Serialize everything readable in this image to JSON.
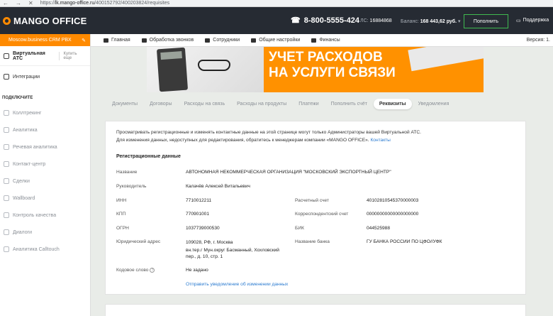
{
  "browser": {
    "url_prefix": "https://",
    "url_host": "lk.mango-office.ru",
    "url_path": "/400152792/400203824/requisites"
  },
  "header": {
    "logo": "MANGO OFFICE",
    "phone": "8-800-5555-424",
    "ls_label": "ЛС:",
    "ls_value": "16884868",
    "balance_label": "Баланс:",
    "balance_value": "168 443,62 руб.",
    "topup_button": "Пополнить",
    "support": "Поддержка"
  },
  "sidebar": {
    "product": "Moscow.business CRM PBX",
    "atc": "Виртуальная АТС",
    "buy_more": "Купить еще",
    "integrations": "Интеграции",
    "connect_section": "ПОДКЛЮЧИТЕ",
    "items": [
      "Коллтрекинг",
      "Аналитика",
      "Речевая аналитика",
      "Контакт-центр",
      "Сделки",
      "Wallboard",
      "Контроль качества",
      "Диалоги",
      "Аналитика Calltouch"
    ]
  },
  "nav": {
    "items": [
      "Главная",
      "Обработка звонков",
      "Сотрудники",
      "Общие настройки",
      "Финансы"
    ],
    "version": "Версия: 1."
  },
  "banner": {
    "line1": "УЧЕТ РАСХОДОВ",
    "line2": "НА УСЛУГИ СВЯЗИ"
  },
  "tabs": [
    "Документы",
    "Договоры",
    "Расходы на связь",
    "Расходы на продукты",
    "Платежи",
    "Пополнить счёт",
    "Реквизиты",
    "Уведомления"
  ],
  "active_tab": "Реквизиты",
  "notice": {
    "line1": "Просматривать регистрационные и изменять контактные данные на этой странице могут только Администраторы вашей Виртуальной АТС.",
    "line2": "Для изменения данных, недоступных для редактирования, обратитесь к менеджерам компании «MANGO OFFICE».",
    "contacts_link": "Контакты"
  },
  "reg": {
    "title": "Регистрационные данные",
    "name_label": "Название",
    "name_value": "АВТОНОМНАЯ НЕКОММЕРЧЕСКАЯ ОРГАНИЗАЦИЯ \"МОСКОВСКИЙ ЭКСПОРТНЫЙ ЦЕНТР\"",
    "head_label": "Руководитель",
    "head_value": "Калачёв Алексей Витальевич",
    "inn_label": "ИНН",
    "inn_value": "7710012211",
    "kpp_label": "КПП",
    "kpp_value": "770901001",
    "ogrn_label": "ОГРН",
    "ogrn_value": "1037739000530",
    "address_label": "Юридический адрес",
    "address_line1": "109028, РФ, г. Москва",
    "address_line2": "вн.тер.г Мун.округ Басманный, Хохловский",
    "address_line3": "пер., д. 10, стр. 1",
    "codeword_label": "Кодовое слово",
    "codeword_value": "Не задано",
    "account_label": "Расчетный счет",
    "account_value": "40102810545370000003",
    "corr_label": "Корреспондентский счет",
    "corr_value": "00000000000000000000",
    "bik_label": "БИК",
    "bik_value": "044525988",
    "bank_label": "Название банка",
    "bank_value": "ГУ БАНКА РОССИИ ПО ЦФО//УФК",
    "send_link": "Отправить уведомление об изменении данных"
  }
}
